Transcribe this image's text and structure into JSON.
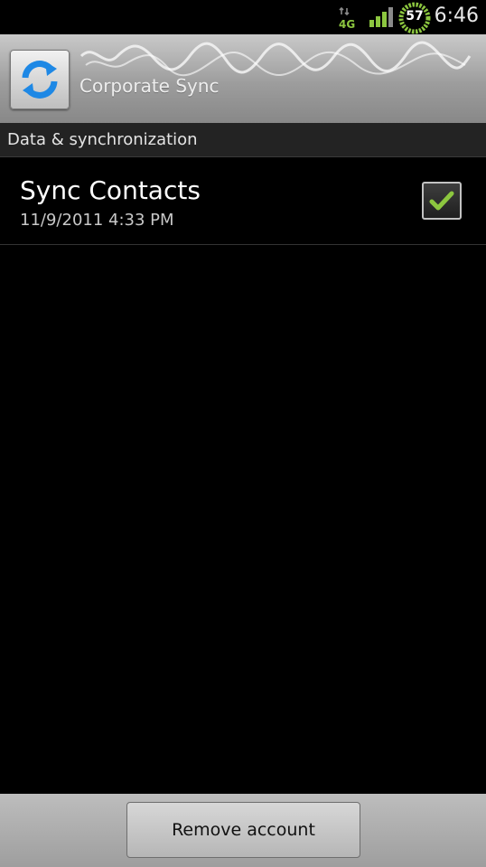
{
  "status_bar": {
    "network_label": "4G",
    "battery_level": "57",
    "time": "6:46",
    "icons": [
      "4g-data-icon",
      "signal-strength-icon",
      "battery-icon"
    ],
    "accent_color": "#8cc63f"
  },
  "header": {
    "title": "Corporate Sync",
    "icon": "sync-icon"
  },
  "section": {
    "title": "Data & synchronization"
  },
  "sync_items": [
    {
      "title": "Sync Contacts",
      "last_synced": "11/9/2011 4:33 PM",
      "checked": true
    }
  ],
  "footer": {
    "remove_account_label": "Remove account"
  }
}
